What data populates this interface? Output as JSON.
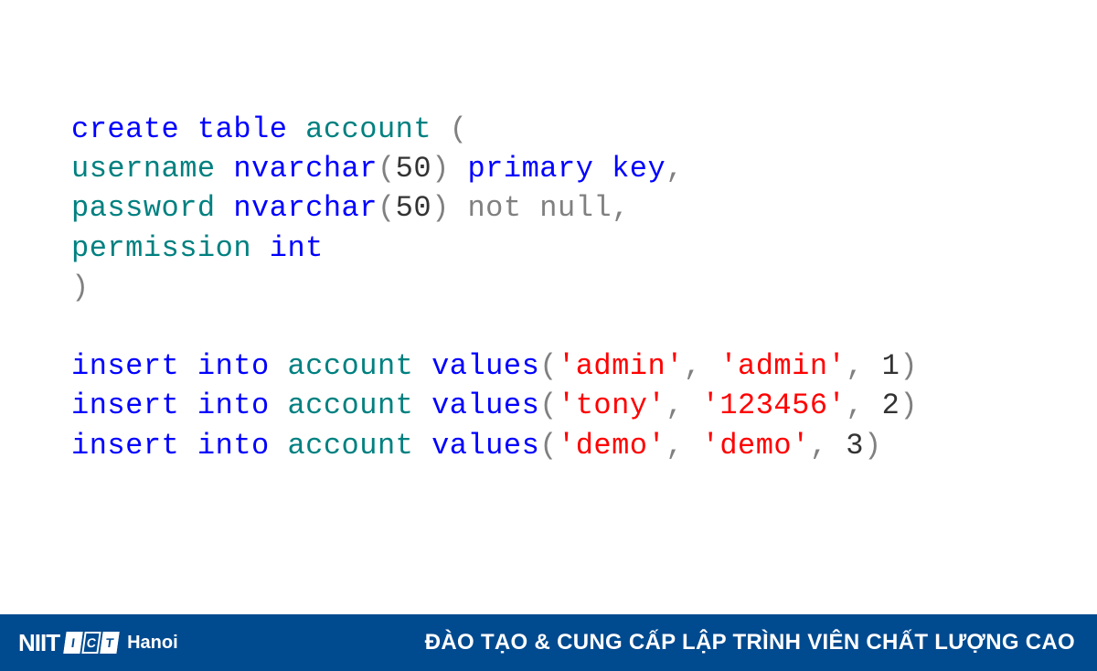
{
  "code": {
    "l1": {
      "create": "create",
      "table": "table",
      "account": "account",
      "paren": "("
    },
    "l2": {
      "indent": "    ",
      "col": "username",
      "type": "nvarchar",
      "op": "(",
      "n": "50",
      "cp": ")",
      "pk": "primary key",
      "comma": ","
    },
    "l3": {
      "indent": "    ",
      "col": "password",
      "type": "nvarchar",
      "op": "(",
      "n": "50",
      "cp": ")",
      "nn": "not null",
      "comma": ","
    },
    "l4": {
      "indent": "    ",
      "col": "permission",
      "type": "int"
    },
    "l5": {
      "cp": ")"
    },
    "i1": {
      "insert": "insert",
      "into": "into",
      "tbl": "account",
      "values": "values",
      "op": "(",
      "s1": "'admin'",
      "c1": ",",
      "s2": "'admin'",
      "c2": ",",
      "n": "1",
      "cp": ")"
    },
    "i2": {
      "insert": "insert",
      "into": "into",
      "tbl": "account",
      "values": "values",
      "op": "(",
      "s1": "'tony'",
      "c1": ",",
      "s2": "'123456'",
      "c2": ",",
      "n": "2",
      "cp": ")"
    },
    "i3": {
      "insert": "insert",
      "into": "into",
      "tbl": "account",
      "values": "values",
      "op": "(",
      "s1": "'demo'",
      "c1": ",",
      "s2": "'demo'",
      "c2": ",",
      "n": "3",
      "cp": ")"
    }
  },
  "footer": {
    "niit": "NIIT",
    "i": "I",
    "c": "C",
    "t": "T",
    "hanoi": "Hanoi",
    "slogan": "ĐÀO TẠO & CUNG CẤP LẬP TRÌNH VIÊN CHẤT LƯỢNG CAO"
  }
}
